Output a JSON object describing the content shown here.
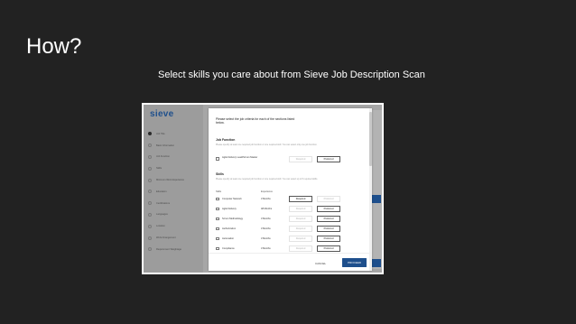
{
  "slide": {
    "title": "How?",
    "subtitle": "Select skills you care about from Sieve Job Description Scan"
  },
  "app": {
    "logo": "sieve",
    "sidebar": {
      "items": [
        {
          "label": "Job Title",
          "active": true
        },
        {
          "label": "Basic Information",
          "active": false
        },
        {
          "label": "Job Function",
          "active": false
        },
        {
          "label": "Skills",
          "active": false
        },
        {
          "label": "Minimum Work Experience",
          "active": false
        },
        {
          "label": "Education",
          "active": false
        },
        {
          "label": "Certifications",
          "active": false
        },
        {
          "label": "Languages",
          "active": false
        },
        {
          "label": "Location",
          "active": false
        },
        {
          "label": "Work Arrangement",
          "active": false
        },
        {
          "label": "Requirement Weightage",
          "active": false
        }
      ]
    },
    "modal": {
      "intro": "Please select the job criteria for each of the sections listed below.",
      "job_function": {
        "heading": "Job Function",
        "helper": "Please specify at least one required job function or one required skill. You can select only one job function.",
        "items": [
          {
            "label": "Agile Delivery Lead/Scrum Master",
            "required": false,
            "preferred": true
          }
        ]
      },
      "skills": {
        "heading": "Skills",
        "helper": "Please specify at least one required job function or one required skill. You can select up to 5 required skills.",
        "col_skills": "Skills",
        "col_experience": "Experience",
        "rows": [
          {
            "skill": "Computer Network",
            "experience": "3 Months",
            "required": true,
            "preferred": false
          },
          {
            "skill": "Agile Delivery",
            "experience": "48 Months",
            "required": false,
            "preferred": true
          },
          {
            "skill": "Scrum Methodology",
            "experience": "3 Months",
            "required": false,
            "preferred": true
          },
          {
            "skill": "Authorization",
            "experience": "3 Months",
            "required": false,
            "preferred": true
          },
          {
            "skill": "Automation",
            "experience": "3 Months",
            "required": false,
            "preferred": true
          },
          {
            "skill": "Compliance",
            "experience": "3 Months",
            "required": false,
            "preferred": true
          }
        ]
      },
      "required_label": "Required",
      "preferred_label": "Preferred",
      "cancel_label": "CANCEL",
      "proceed_label": "PROCEED"
    }
  },
  "colors": {
    "background": "#222222",
    "accent": "#1e4f8c",
    "overlay": "#a6a6a6"
  }
}
